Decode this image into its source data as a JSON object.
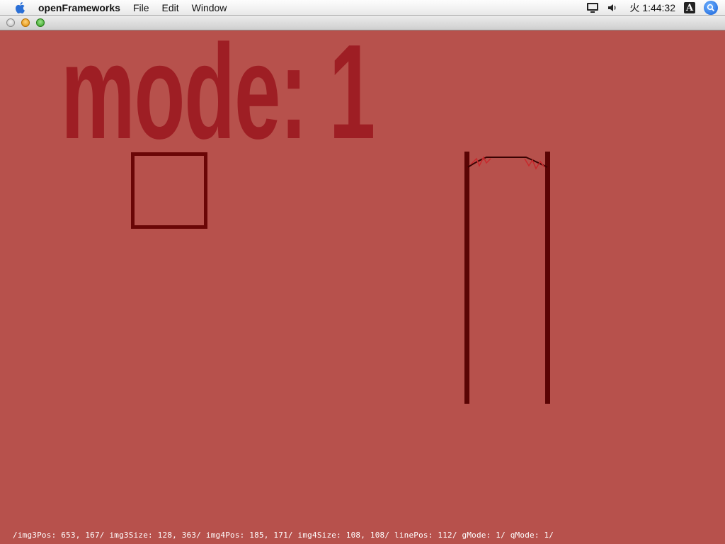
{
  "menubar": {
    "app_name": "openFrameworks",
    "items": [
      "File",
      "Edit",
      "Window"
    ],
    "clock": "火 1:44:32",
    "input_menu_letter": "A"
  },
  "canvas": {
    "mode_text": "mode: 1",
    "colors": {
      "background": "#b7514c",
      "mode_text": "#9e1e24",
      "square_stroke": "#6a0606",
      "line_stroke": "#5a0404",
      "sparkle": "#c8282c"
    },
    "status_line": "/img3Pos: 653, 167/ img3Size: 128, 363/ img4Pos: 185, 171/ img4Size: 108, 108/ linePos: 112/ gMode: 1/ qMode: 1/"
  }
}
